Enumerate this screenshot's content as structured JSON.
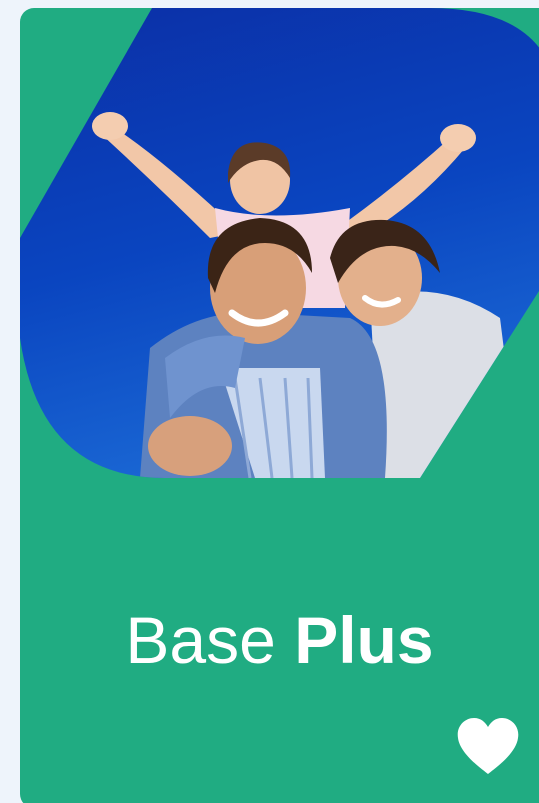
{
  "card": {
    "title_regular": "Base",
    "title_bold": "Plus",
    "accent_color": "#20ac82",
    "sky_color": "#0a3fb8",
    "image_icon": "family-photo",
    "favorite_icon": "heart-icon"
  }
}
